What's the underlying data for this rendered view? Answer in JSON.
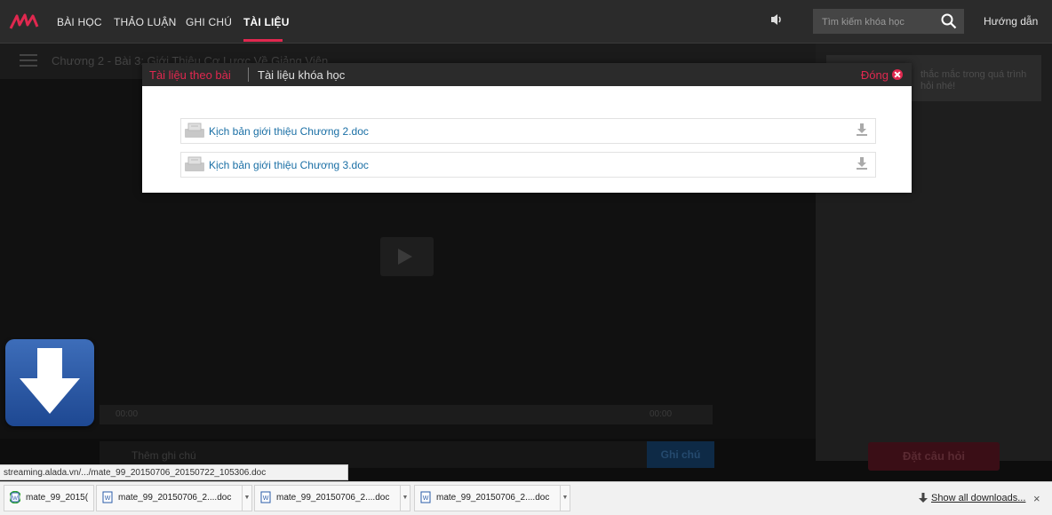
{
  "nav": {
    "items": [
      "BÀI HỌC",
      "THẢO LUẬN",
      "GHI CHÚ",
      "TÀI LIỆU"
    ],
    "active": "TÀI LIỆU",
    "search_placeholder": "Tìm kiếm khóa học",
    "guide": "Hướng dẫn"
  },
  "lesson": {
    "title": "Chương 2 -  Bài 3: Giới Thiệu Cơ Lược Về Giảng Viên",
    "time_start": "00:00",
    "time_end": "00:00",
    "note_placeholder": "Thêm ghi chú",
    "note_button": "Ghi chú"
  },
  "right_panel": {
    "tip": "thắc mắc trong quá trình hỏi nhé!",
    "ask_button": "Đặt câu hỏi"
  },
  "modal": {
    "tab_lesson": "Tài liệu theo bài",
    "tab_course": "Tài liệu khóa học",
    "close": "Đóng",
    "documents": [
      {
        "name": "Kịch bản giới thiệu Chương 2.doc"
      },
      {
        "name": "Kịch bản giới thiệu Chương 3.doc"
      }
    ]
  },
  "status_url": "streaming.alada.vn/.../mate_99_20150706_20150722_105306.doc",
  "downloads": {
    "items": [
      {
        "name": "mate_99_2015("
      },
      {
        "name": "mate_99_20150706_2....doc"
      },
      {
        "name": "mate_99_20150706_2....doc"
      },
      {
        "name": "mate_99_20150706_2....doc"
      }
    ],
    "show_all": "Show all downloads...",
    "close": "×"
  },
  "colors": {
    "accent": "#e0284f",
    "link": "#1a6fa5",
    "nav_bg": "#2b2b2b"
  }
}
